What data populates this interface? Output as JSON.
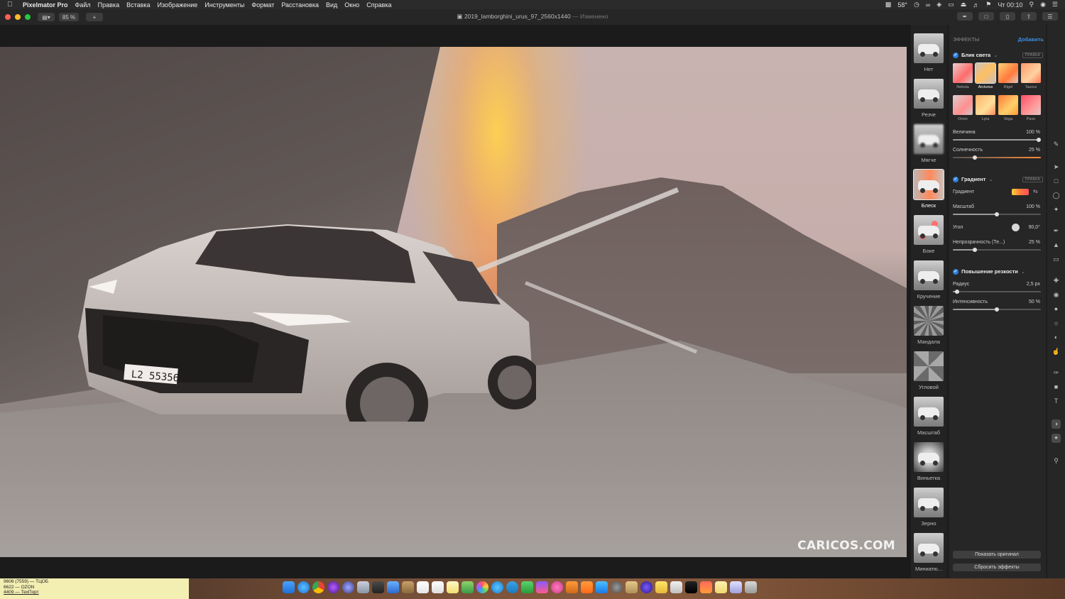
{
  "menubar": {
    "app_name": "Pixelmator Pro",
    "items": [
      "Файл",
      "Правка",
      "Вставка",
      "Изображение",
      "Инструменты",
      "Формат",
      "Расстановка",
      "Вид",
      "Окно",
      "Справка"
    ],
    "temperature": "58°",
    "clock": "Чт 00:10"
  },
  "toolbar": {
    "zoom": "85 %",
    "add_label": "+",
    "doc_title": "2019_lamborghini_urus_97_2560x1440",
    "doc_status": "— Изменено"
  },
  "canvas": {
    "watermark": "CARICOS.COM",
    "plate": "L2 55356"
  },
  "effects_browser": {
    "items": [
      {
        "label": "Нет"
      },
      {
        "label": "Резче"
      },
      {
        "label": "Мягче"
      },
      {
        "label": "Блеск"
      },
      {
        "label": "Боке"
      },
      {
        "label": "Кручение"
      },
      {
        "label": "Мандала"
      },
      {
        "label": "Угловой"
      },
      {
        "label": "Масштаб"
      },
      {
        "label": "Виньетка"
      },
      {
        "label": "Зерно"
      },
      {
        "label": "Миниатю..."
      }
    ],
    "selected": "Блеск"
  },
  "panel": {
    "header": "ЭФФЕКТЫ",
    "add_label": "Добавить",
    "edit_badge": "ПРАВКА",
    "light_leak": {
      "title": "Блик света",
      "presets": [
        "Nebula",
        "Arcturus",
        "Rigel",
        "Taurus",
        "Orion",
        "Lyra",
        "Vega",
        "Pavo"
      ],
      "selected_preset": "Arcturus",
      "magnitude_label": "Величина",
      "magnitude_value": "100 %",
      "magnitude_level": 1.0,
      "sunniness_label": "Солнечность",
      "sunniness_value": "25 %",
      "sunniness_level": 0.25
    },
    "gradient": {
      "title": "Градиент",
      "gradient_label": "Градиент",
      "scale_label": "Масштаб",
      "scale_value": "100 %",
      "scale_level": 0.5,
      "angle_label": "Угол",
      "angle_value": "90,0°",
      "opacity_label": "Непрозрачность (Те...)",
      "opacity_value": "25 %",
      "opacity_level": 0.25
    },
    "sharpen": {
      "title": "Повышение резкости",
      "radius_label": "Радиус",
      "radius_value": "2,5 px",
      "radius_level": 0.05,
      "intensity_label": "Интенсивность",
      "intensity_value": "50 %",
      "intensity_level": 0.5
    },
    "show_original": "Показать оригинал",
    "reset_effects": "Сбросить эффекты"
  },
  "notes": {
    "line1": "9608 (7559) — ТЦОБ",
    "line2": "6622 — OZON",
    "line3": "4409 — ТехПорт"
  },
  "colors": {
    "accent": "#2f7fe0",
    "panel_bg": "#262626",
    "menubar_bg": "#2b2b2b"
  }
}
